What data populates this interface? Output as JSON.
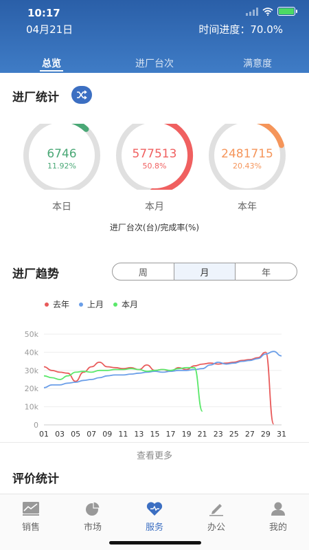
{
  "status": {
    "time": "10:17"
  },
  "header": {
    "date": "04月21日",
    "progress_label": "时间进度：",
    "progress_value": "70.0%",
    "tabs": [
      {
        "label": "总览",
        "active": true
      },
      {
        "label": "进厂台次",
        "active": false
      },
      {
        "label": "满意度",
        "active": false
      }
    ]
  },
  "stats": {
    "title": "进厂统计",
    "unit_note": "进厂台次(台)/完成率(%)",
    "gauges": [
      {
        "value": "6746",
        "percent": "11.92%",
        "label": "本日",
        "fraction": 0.1192,
        "color": "#4aa876"
      },
      {
        "value": "577513",
        "percent": "50.8%",
        "label": "本月",
        "fraction": 0.508,
        "color": "#f06060"
      },
      {
        "value": "2481715",
        "percent": "20.43%",
        "label": "本年",
        "fraction": 0.2043,
        "color": "#f5955a"
      }
    ],
    "track_color": "#e0e0e0"
  },
  "trend": {
    "title": "进厂趋势",
    "periods": [
      {
        "label": "周",
        "selected": false
      },
      {
        "label": "月",
        "selected": true
      },
      {
        "label": "年",
        "selected": false
      }
    ],
    "more_label": "查看更多"
  },
  "rating": {
    "title": "评价统计"
  },
  "chart_data": {
    "type": "line",
    "ylim": [
      0,
      50000
    ],
    "yticks": [
      "0",
      "10k",
      "20k",
      "30k",
      "40k",
      "50k"
    ],
    "xtick_labels": [
      "01",
      "03",
      "05",
      "07",
      "09",
      "11",
      "13",
      "15",
      "17",
      "19",
      "21",
      "23",
      "25",
      "27",
      "29",
      "31"
    ],
    "x": [
      1,
      2,
      3,
      4,
      5,
      6,
      7,
      8,
      9,
      10,
      11,
      12,
      13,
      14,
      15,
      16,
      17,
      18,
      19,
      20,
      21,
      22,
      23,
      24,
      25,
      26,
      27,
      28,
      29,
      30,
      31
    ],
    "series": [
      {
        "name": "去年",
        "color": "#e85a5a",
        "values": [
          32000,
          30000,
          29000,
          28500,
          24000,
          29000,
          32000,
          34500,
          32000,
          31500,
          31000,
          31500,
          30500,
          33000,
          30000,
          30500,
          29500,
          31500,
          30500,
          32500,
          33500,
          34000,
          33500,
          34000,
          34500,
          35500,
          36000,
          37000,
          40000,
          500,
          null
        ]
      },
      {
        "name": "上月",
        "color": "#6a9ee8",
        "values": [
          20500,
          22000,
          22000,
          23000,
          23500,
          24500,
          25000,
          26000,
          27000,
          27500,
          27500,
          28000,
          28500,
          29000,
          29500,
          29000,
          29500,
          30000,
          30000,
          30500,
          31000,
          33000,
          34500,
          33500,
          34000,
          35000,
          35500,
          36500,
          39000,
          40500,
          38000
        ]
      },
      {
        "name": "本月",
        "color": "#5ae86a",
        "values": [
          27000,
          26000,
          25000,
          27000,
          29000,
          29500,
          29000,
          30000,
          30000,
          30500,
          30500,
          31000,
          30500,
          29500,
          30000,
          30500,
          30000,
          31000,
          31500,
          31500,
          7500,
          null,
          null,
          null,
          null,
          null,
          null,
          null,
          null,
          null,
          null
        ]
      }
    ]
  },
  "tabbar": {
    "items": [
      {
        "label": "销售",
        "icon": "line-chart-icon",
        "active": false
      },
      {
        "label": "市场",
        "icon": "pie-chart-icon",
        "active": false
      },
      {
        "label": "服务",
        "icon": "heart-icon",
        "active": true
      },
      {
        "label": "办公",
        "icon": "pencil-icon",
        "active": false
      },
      {
        "label": "我的",
        "icon": "user-icon",
        "active": false
      }
    ]
  }
}
